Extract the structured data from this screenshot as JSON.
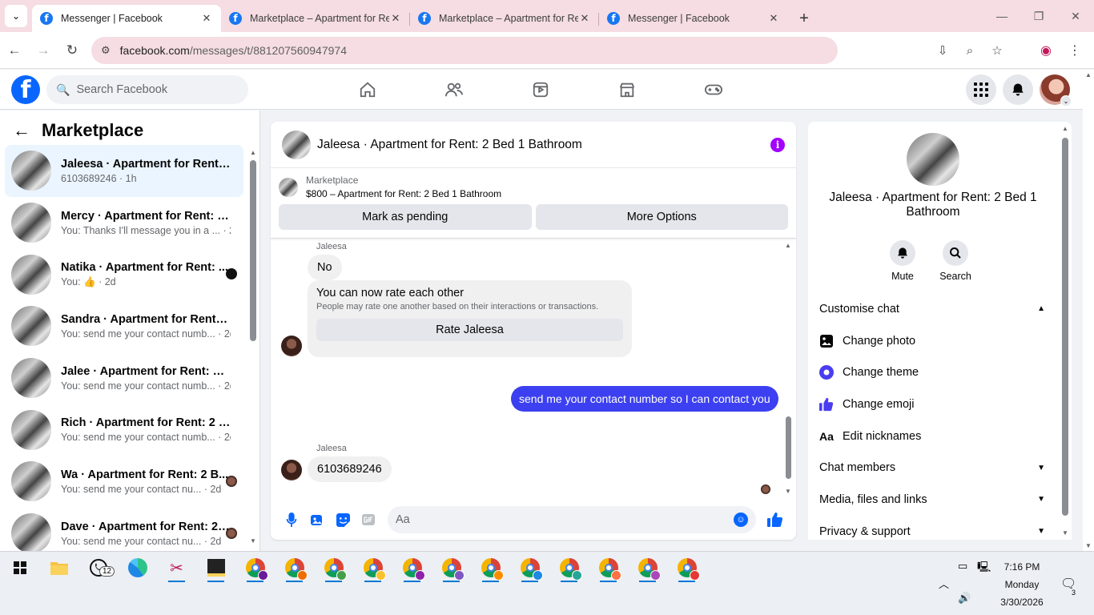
{
  "browser": {
    "tabs": [
      {
        "title": "Messenger | Facebook",
        "active": true
      },
      {
        "title": "Marketplace – Apartment for Rent",
        "active": false
      },
      {
        "title": "Marketplace – Apartment for Rent",
        "active": false
      },
      {
        "title": "Messenger | Facebook",
        "active": false
      }
    ],
    "url_host": "facebook.com",
    "url_path": "/messages/t/881207560947974"
  },
  "fb_header": {
    "search_placeholder": "Search Facebook"
  },
  "left_panel": {
    "title": "Marketplace",
    "conversations": [
      {
        "name": "Jaleesa · Apartment for Rent: 2 ...",
        "meta": "6103689246 · 1h",
        "active": true
      },
      {
        "name": "Mercy · Apartment for Rent: 2 ...",
        "meta": "You: Thanks I'll message you in a ... · 2d"
      },
      {
        "name": "Natika · Apartment for Rent: ...",
        "meta": "You: 👍 · 2d"
      },
      {
        "name": "Sandra · Apartment for Rent: 2 ...",
        "meta": "You: send me your contact numb... · 2d"
      },
      {
        "name": "Jalee · Apartment for Rent: 2 Be...",
        "meta": "You: send me your contact numb... · 2d"
      },
      {
        "name": "Rich · Apartment for Rent: 2 Be...",
        "meta": "You: send me your contact numb... · 2d"
      },
      {
        "name": "Wa · Apartment for Rent: 2 B...",
        "meta": "You: send me your contact nu... · 2d"
      },
      {
        "name": "Dave · Apartment for Rent: 2 ...",
        "meta": "You: send me your contact nu... · 2d"
      }
    ]
  },
  "chat": {
    "header_name": "Jaleesa · Apartment for Rent: 2 Bed 1 Bathroom",
    "listing_source": "Marketplace",
    "listing_price_title": "$800 – Apartment for Rent: 2 Bed 1 Bathroom",
    "mark_pending_label": "Mark as pending",
    "more_options_label": "More Options",
    "sender1": "Jaleesa",
    "msg1": "No",
    "rate_title": "You can now rate each other",
    "rate_sub": "People may rate one another based on their interactions or transactions.",
    "rate_button": "Rate Jaleesa",
    "msg_out": "send me your contact number so I can contact you",
    "sender2": "Jaleesa",
    "msg2": "6103689246",
    "composer_placeholder": "Aa"
  },
  "right_panel": {
    "name": "Jaleesa · Apartment for Rent: 2 Bed 1 Bathroom",
    "mute_label": "Mute",
    "search_label": "Search",
    "customise_chat": "Customise chat",
    "change_photo": "Change photo",
    "change_theme": "Change theme",
    "change_emoji": "Change emoji",
    "edit_nicknames": "Edit nicknames",
    "chat_members": "Chat members",
    "media_files_links": "Media, files and links",
    "privacy_support": "Privacy & support",
    "nickname_icon_text": "Aa"
  },
  "taskbar": {
    "whatsapp_badge": "12",
    "time": "7:16 PM",
    "day": "Monday",
    "date": "3/30/2026",
    "notifications": "3"
  },
  "colors": {
    "fb_blue": "#0866ff",
    "outgoing_bubble": "#3c40f0",
    "info_purple": "#a200ff",
    "tab_bar": "#f5dde3"
  }
}
